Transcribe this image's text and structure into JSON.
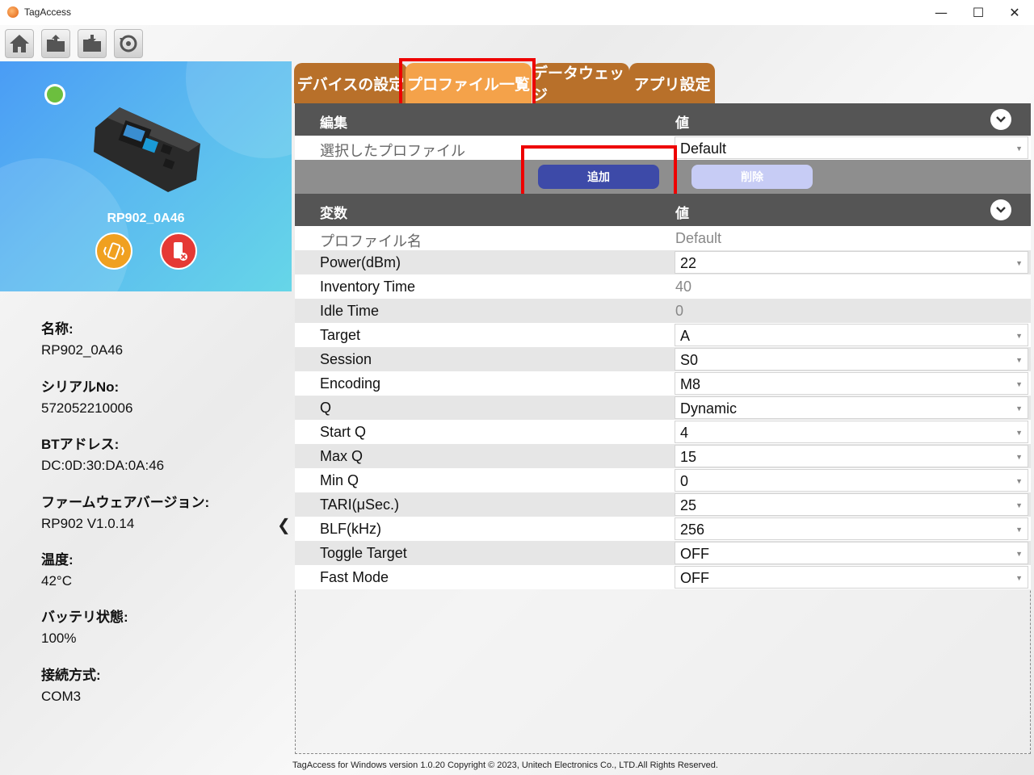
{
  "window": {
    "title": "TagAccess",
    "minimize": "—",
    "maximize": "☐",
    "close": "✕"
  },
  "toolbar": {
    "items": [
      {
        "name": "home-icon"
      },
      {
        "name": "open-folder-icon"
      },
      {
        "name": "save-folder-icon"
      },
      {
        "name": "reset-icon"
      }
    ]
  },
  "device": {
    "name": "RP902_0A46",
    "status_color": "#6cbf3e",
    "vibrate_icon_color": "#f0a020",
    "disconnect_icon_color": "#e53935"
  },
  "info": [
    {
      "label": "名称:",
      "value": "RP902_0A46"
    },
    {
      "label": "シリアルNo:",
      "value": "572052210006"
    },
    {
      "label": "BTアドレス:",
      "value": "DC:0D:30:DA:0A:46"
    },
    {
      "label": "ファームウェアバージョン:",
      "value": "RP902 V1.0.14"
    },
    {
      "label": "温度:",
      "value": "42°C"
    },
    {
      "label": "バッテリ状態:",
      "value": "100%"
    },
    {
      "label": "接続方式:",
      "value": "COM3"
    }
  ],
  "tabs": [
    {
      "label": "デバイスの設定"
    },
    {
      "label": "プロファイル一覧"
    },
    {
      "label": "データウェッジ"
    },
    {
      "label": "アプリ設定"
    }
  ],
  "edit_section": {
    "col1": "編集",
    "col2": "値",
    "selected_label": "選択したプロファイル",
    "selected_value": "Default",
    "add_button": "追加",
    "delete_button": "削除"
  },
  "var_section": {
    "col1": "変数",
    "col2": "値",
    "rows": [
      {
        "name": "プロファイル名",
        "value": "Default"
      },
      {
        "name": "Power(dBm)",
        "value": "22"
      },
      {
        "name": "Inventory Time",
        "value": "40"
      },
      {
        "name": "Idle Time",
        "value": "0"
      },
      {
        "name": "Target",
        "value": "A"
      },
      {
        "name": "Session",
        "value": "S0"
      },
      {
        "name": "Encoding",
        "value": "M8"
      },
      {
        "name": "Q",
        "value": "Dynamic"
      },
      {
        "name": "Start Q",
        "value": "4"
      },
      {
        "name": "Max Q",
        "value": "15"
      },
      {
        "name": "Min Q",
        "value": "0"
      },
      {
        "name": "TARI(μSec.)",
        "value": "25"
      },
      {
        "name": "BLF(kHz)",
        "value": "256"
      },
      {
        "name": "Toggle Target",
        "value": "OFF"
      },
      {
        "name": "Fast Mode",
        "value": "OFF"
      }
    ]
  },
  "footer": "TagAccess for Windows version 1.0.20 Copyright © 2023, Unitech Electronics Co., LTD.All Rights Reserved.",
  "colors": {
    "tab": "#b8702a",
    "tab_active": "#f4a24a",
    "add_button": "#3d4aa8",
    "delete_button": "#c7ccf5",
    "highlight": "#e00000"
  }
}
